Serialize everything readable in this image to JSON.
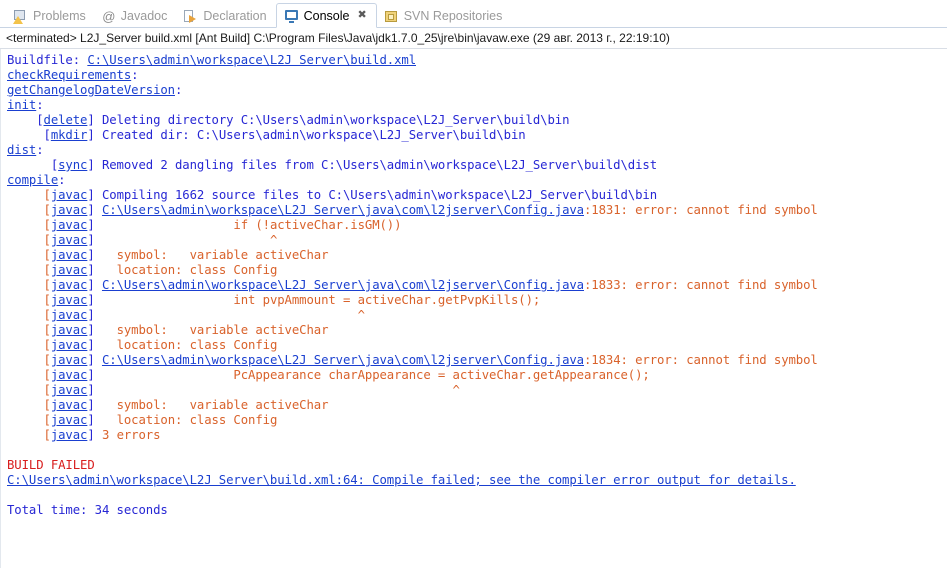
{
  "tabs": [
    {
      "label": "Problems",
      "icon": "problems-icon",
      "active": false,
      "closable": false
    },
    {
      "label": "Javadoc",
      "icon": "at-icon",
      "active": false,
      "closable": false
    },
    {
      "label": "Declaration",
      "icon": "declaration-icon",
      "active": false,
      "closable": false
    },
    {
      "label": "Console",
      "icon": "console-icon",
      "active": true,
      "closable": true
    },
    {
      "label": "SVN Repositories",
      "icon": "svn-repositories-icon",
      "active": false,
      "closable": false
    }
  ],
  "close_glyph": "✖",
  "process_header": "<terminated> L2J_Server build.xml [Ant Build] C:\\Program Files\\Java\\jdk1.7.0_25\\jre\\bin\\javaw.exe (29 авг. 2013 г., 22:19:10)",
  "colors": {
    "plain_blue": "#2727d4",
    "hyperlink": "#1a3fd0",
    "error_orange": "#d9622b",
    "build_failed_red": "#d81e1e",
    "tab_active_text": "#000000",
    "tab_inactive_text": "#9a9a9a",
    "background": "#ffffff"
  },
  "console_lines": [
    {
      "id": "buildfile",
      "segments": [
        {
          "text": "Buildfile: ",
          "style": "blue"
        },
        {
          "text": "C:\\Users\\admin\\workspace\\L2J Server\\build.xml",
          "style": "link"
        }
      ]
    },
    {
      "id": "target-checkrequirements",
      "segments": [
        {
          "text": "checkRequirements",
          "style": "link"
        },
        {
          "text": ":",
          "style": "blue"
        }
      ]
    },
    {
      "id": "target-getchangelogdateversion",
      "segments": [
        {
          "text": "getChangelogDateVersion",
          "style": "link"
        },
        {
          "text": ":",
          "style": "blue"
        }
      ]
    },
    {
      "id": "target-init",
      "segments": [
        {
          "text": "init",
          "style": "link"
        },
        {
          "text": ":",
          "style": "blue"
        }
      ]
    },
    {
      "id": "delete-line",
      "segments": [
        {
          "text": "    [",
          "style": "blue"
        },
        {
          "text": "delete",
          "style": "link"
        },
        {
          "text": "] Deleting directory C:\\Users\\admin\\workspace\\L2J_Server\\build\\bin",
          "style": "blue"
        }
      ]
    },
    {
      "id": "mkdir-line",
      "segments": [
        {
          "text": "     [",
          "style": "blue"
        },
        {
          "text": "mkdir",
          "style": "link"
        },
        {
          "text": "] Created dir: C:\\Users\\admin\\workspace\\L2J_Server\\build\\bin",
          "style": "blue"
        }
      ]
    },
    {
      "id": "target-dist",
      "segments": [
        {
          "text": "dist",
          "style": "link"
        },
        {
          "text": ":",
          "style": "blue"
        }
      ]
    },
    {
      "id": "sync-line",
      "segments": [
        {
          "text": "      [",
          "style": "blue"
        },
        {
          "text": "sync",
          "style": "link"
        },
        {
          "text": "] Removed 2 dangling files from C:\\Users\\admin\\workspace\\L2J_Server\\build\\dist",
          "style": "blue"
        }
      ]
    },
    {
      "id": "target-compile",
      "segments": [
        {
          "text": "compile",
          "style": "link"
        },
        {
          "text": ":",
          "style": "blue"
        }
      ]
    },
    {
      "id": "javac-compiling",
      "segments": [
        {
          "text": "     [",
          "style": "tag"
        },
        {
          "text": "javac",
          "style": "tag-link"
        },
        {
          "text": "] Compiling 1662 source files to C:\\Users\\admin\\workspace\\L2J_Server\\build\\bin",
          "style": "blue"
        }
      ]
    },
    {
      "id": "javac-error-1",
      "segments": [
        {
          "text": "     [",
          "style": "tag"
        },
        {
          "text": "javac",
          "style": "tag-link"
        },
        {
          "text": "] ",
          "style": "blue"
        },
        {
          "text": "C:\\Users\\admin\\workspace\\L2J Server\\java\\com\\l2jserver\\Config.java",
          "style": "err-link"
        },
        {
          "text": ":1831: error: cannot find symbol",
          "style": "err"
        }
      ]
    },
    {
      "id": "javac-code-1",
      "segments": [
        {
          "text": "     [",
          "style": "tag"
        },
        {
          "text": "javac",
          "style": "tag-link"
        },
        {
          "text": "] ",
          "style": "blue"
        },
        {
          "text": "                  if (!activeChar.isGM())",
          "style": "err"
        }
      ]
    },
    {
      "id": "javac-caret-1",
      "segments": [
        {
          "text": "     [",
          "style": "tag"
        },
        {
          "text": "javac",
          "style": "tag-link"
        },
        {
          "text": "] ",
          "style": "blue"
        },
        {
          "text": "                       ^",
          "style": "err"
        }
      ]
    },
    {
      "id": "javac-symbol-1",
      "segments": [
        {
          "text": "     [",
          "style": "tag"
        },
        {
          "text": "javac",
          "style": "tag-link"
        },
        {
          "text": "] ",
          "style": "blue"
        },
        {
          "text": "  symbol:   variable activeChar",
          "style": "err"
        }
      ]
    },
    {
      "id": "javac-location-1",
      "segments": [
        {
          "text": "     [",
          "style": "tag"
        },
        {
          "text": "javac",
          "style": "tag-link"
        },
        {
          "text": "] ",
          "style": "blue"
        },
        {
          "text": "  location: class Config",
          "style": "err"
        }
      ]
    },
    {
      "id": "javac-error-2",
      "segments": [
        {
          "text": "     [",
          "style": "tag"
        },
        {
          "text": "javac",
          "style": "tag-link"
        },
        {
          "text": "] ",
          "style": "blue"
        },
        {
          "text": "C:\\Users\\admin\\workspace\\L2J Server\\java\\com\\l2jserver\\Config.java",
          "style": "err-link"
        },
        {
          "text": ":1833: error: cannot find symbol",
          "style": "err"
        }
      ]
    },
    {
      "id": "javac-code-2",
      "segments": [
        {
          "text": "     [",
          "style": "tag"
        },
        {
          "text": "javac",
          "style": "tag-link"
        },
        {
          "text": "] ",
          "style": "blue"
        },
        {
          "text": "                  int pvpAmmount = activeChar.getPvpKills();",
          "style": "err"
        }
      ]
    },
    {
      "id": "javac-caret-2",
      "segments": [
        {
          "text": "     [",
          "style": "tag"
        },
        {
          "text": "javac",
          "style": "tag-link"
        },
        {
          "text": "] ",
          "style": "blue"
        },
        {
          "text": "                                   ^",
          "style": "err"
        }
      ]
    },
    {
      "id": "javac-symbol-2",
      "segments": [
        {
          "text": "     [",
          "style": "tag"
        },
        {
          "text": "javac",
          "style": "tag-link"
        },
        {
          "text": "] ",
          "style": "blue"
        },
        {
          "text": "  symbol:   variable activeChar",
          "style": "err"
        }
      ]
    },
    {
      "id": "javac-location-2",
      "segments": [
        {
          "text": "     [",
          "style": "tag"
        },
        {
          "text": "javac",
          "style": "tag-link"
        },
        {
          "text": "] ",
          "style": "blue"
        },
        {
          "text": "  location: class Config",
          "style": "err"
        }
      ]
    },
    {
      "id": "javac-error-3",
      "segments": [
        {
          "text": "     [",
          "style": "tag"
        },
        {
          "text": "javac",
          "style": "tag-link"
        },
        {
          "text": "] ",
          "style": "blue"
        },
        {
          "text": "C:\\Users\\admin\\workspace\\L2J Server\\java\\com\\l2jserver\\Config.java",
          "style": "err-link"
        },
        {
          "text": ":1834: error: cannot find symbol",
          "style": "err"
        }
      ]
    },
    {
      "id": "javac-code-3",
      "segments": [
        {
          "text": "     [",
          "style": "tag"
        },
        {
          "text": "javac",
          "style": "tag-link"
        },
        {
          "text": "] ",
          "style": "blue"
        },
        {
          "text": "                  PcAppearance charAppearance = activeChar.getAppearance();",
          "style": "err"
        }
      ]
    },
    {
      "id": "javac-caret-3",
      "segments": [
        {
          "text": "     [",
          "style": "tag"
        },
        {
          "text": "javac",
          "style": "tag-link"
        },
        {
          "text": "] ",
          "style": "blue"
        },
        {
          "text": "                                                ^",
          "style": "err"
        }
      ]
    },
    {
      "id": "javac-symbol-3",
      "segments": [
        {
          "text": "     [",
          "style": "tag"
        },
        {
          "text": "javac",
          "style": "tag-link"
        },
        {
          "text": "] ",
          "style": "blue"
        },
        {
          "text": "  symbol:   variable activeChar",
          "style": "err"
        }
      ]
    },
    {
      "id": "javac-location-3",
      "segments": [
        {
          "text": "     [",
          "style": "tag"
        },
        {
          "text": "javac",
          "style": "tag-link"
        },
        {
          "text": "] ",
          "style": "blue"
        },
        {
          "text": "  location: class Config",
          "style": "err"
        }
      ]
    },
    {
      "id": "javac-error-count",
      "segments": [
        {
          "text": "     [",
          "style": "tag"
        },
        {
          "text": "javac",
          "style": "tag-link"
        },
        {
          "text": "] ",
          "style": "blue"
        },
        {
          "text": "3 errors",
          "style": "err"
        }
      ]
    },
    {
      "id": "blank-1",
      "segments": []
    },
    {
      "id": "build-failed",
      "segments": [
        {
          "text": "BUILD FAILED",
          "style": "failed"
        }
      ]
    },
    {
      "id": "build-failed-detail",
      "segments": [
        {
          "text": "C:\\Users\\admin\\workspace\\L2J Server\\build.xml:64: Compile failed; see the compiler error output for details.",
          "style": "link"
        }
      ]
    },
    {
      "id": "blank-2",
      "segments": []
    },
    {
      "id": "total-time",
      "segments": [
        {
          "text": "Total time: 34 seconds",
          "style": "blue"
        }
      ]
    }
  ]
}
